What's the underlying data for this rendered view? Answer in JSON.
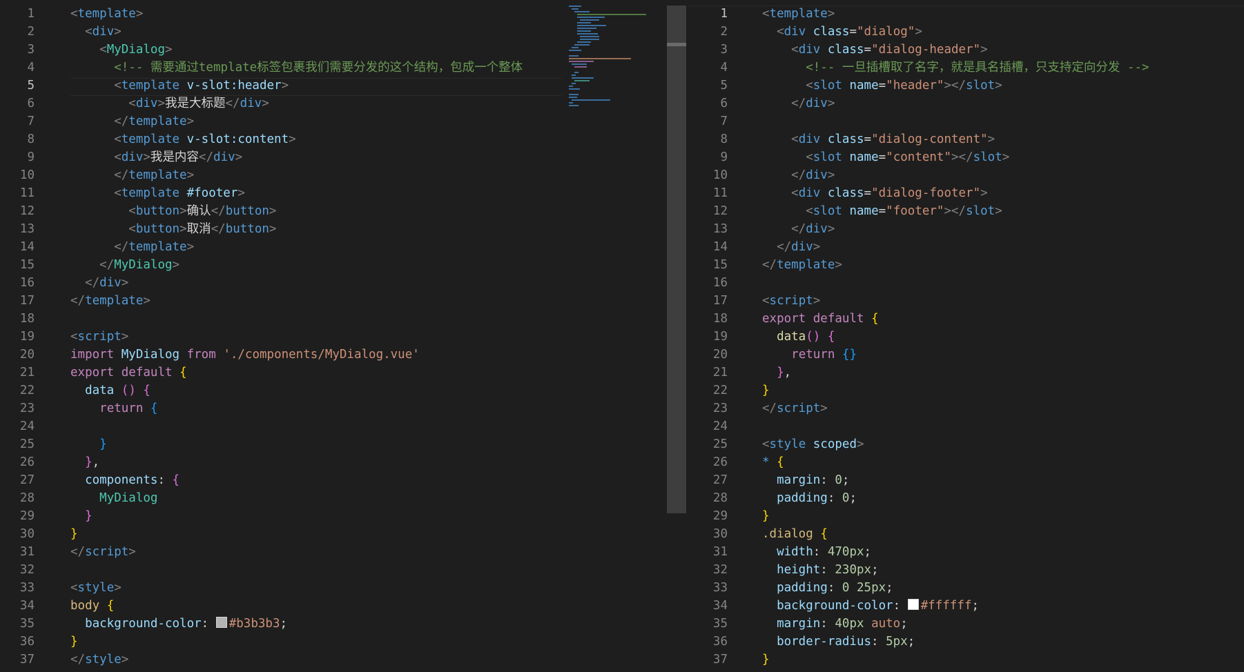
{
  "swatch_colors": {
    "left_swatch": "#b3b3b3",
    "right_swatch": "#ffffff"
  },
  "left_editor": {
    "active_line": 5,
    "lines": [
      [
        [
          "tag",
          "<"
        ],
        [
          "el",
          "template"
        ],
        [
          "tag",
          ">"
        ]
      ],
      [
        [
          "def",
          "  "
        ],
        [
          "tag",
          "<"
        ],
        [
          "el",
          "div"
        ],
        [
          "tag",
          ">"
        ]
      ],
      [
        [
          "def",
          "    "
        ],
        [
          "tag",
          "<"
        ],
        [
          "comp",
          "MyDialog"
        ],
        [
          "tag",
          ">"
        ]
      ],
      [
        [
          "def",
          "      "
        ],
        [
          "cmt",
          "<!-- 需要通过template标签包裹我们需要分发的这个结构，包成一个整体"
        ]
      ],
      [
        [
          "def",
          "      "
        ],
        [
          "tag",
          "<"
        ],
        [
          "el",
          "template"
        ],
        [
          "def",
          " "
        ],
        [
          "attr",
          "v-slot:header"
        ],
        [
          "tag",
          ">"
        ]
      ],
      [
        [
          "def",
          "        "
        ],
        [
          "tag",
          "<"
        ],
        [
          "el",
          "div"
        ],
        [
          "tag",
          ">"
        ],
        [
          "def",
          "我是大标题"
        ],
        [
          "tag",
          "</"
        ],
        [
          "el",
          "div"
        ],
        [
          "tag",
          ">"
        ]
      ],
      [
        [
          "def",
          "      "
        ],
        [
          "tag",
          "</"
        ],
        [
          "el",
          "template"
        ],
        [
          "tag",
          ">"
        ]
      ],
      [
        [
          "def",
          "      "
        ],
        [
          "tag",
          "<"
        ],
        [
          "el",
          "template"
        ],
        [
          "def",
          " "
        ],
        [
          "attr",
          "v-slot:content"
        ],
        [
          "tag",
          ">"
        ]
      ],
      [
        [
          "def",
          "      "
        ],
        [
          "tag",
          "<"
        ],
        [
          "el",
          "div"
        ],
        [
          "tag",
          ">"
        ],
        [
          "def",
          "我是内容"
        ],
        [
          "tag",
          "</"
        ],
        [
          "el",
          "div"
        ],
        [
          "tag",
          ">"
        ]
      ],
      [
        [
          "def",
          "      "
        ],
        [
          "tag",
          "</"
        ],
        [
          "el",
          "template"
        ],
        [
          "tag",
          ">"
        ]
      ],
      [
        [
          "def",
          "      "
        ],
        [
          "tag",
          "<"
        ],
        [
          "el",
          "template"
        ],
        [
          "def",
          " "
        ],
        [
          "attr",
          "#footer"
        ],
        [
          "tag",
          ">"
        ]
      ],
      [
        [
          "def",
          "        "
        ],
        [
          "tag",
          "<"
        ],
        [
          "el",
          "button"
        ],
        [
          "tag",
          ">"
        ],
        [
          "def",
          "确认"
        ],
        [
          "tag",
          "</"
        ],
        [
          "el",
          "button"
        ],
        [
          "tag",
          ">"
        ]
      ],
      [
        [
          "def",
          "        "
        ],
        [
          "tag",
          "<"
        ],
        [
          "el",
          "button"
        ],
        [
          "tag",
          ">"
        ],
        [
          "def",
          "取消"
        ],
        [
          "tag",
          "</"
        ],
        [
          "el",
          "button"
        ],
        [
          "tag",
          ">"
        ]
      ],
      [
        [
          "def",
          "      "
        ],
        [
          "tag",
          "</"
        ],
        [
          "el",
          "template"
        ],
        [
          "tag",
          ">"
        ]
      ],
      [
        [
          "def",
          "    "
        ],
        [
          "tag",
          "</"
        ],
        [
          "comp",
          "MyDialog"
        ],
        [
          "tag",
          ">"
        ]
      ],
      [
        [
          "def",
          "  "
        ],
        [
          "tag",
          "</"
        ],
        [
          "el",
          "div"
        ],
        [
          "tag",
          ">"
        ]
      ],
      [
        [
          "tag",
          "</"
        ],
        [
          "el",
          "template"
        ],
        [
          "tag",
          ">"
        ]
      ],
      [],
      [
        [
          "tag",
          "<"
        ],
        [
          "el",
          "script"
        ],
        [
          "tag",
          ">"
        ]
      ],
      [
        [
          "kw",
          "import"
        ],
        [
          "def",
          " "
        ],
        [
          "prop",
          "MyDialog"
        ],
        [
          "def",
          " "
        ],
        [
          "kw",
          "from"
        ],
        [
          "def",
          " "
        ],
        [
          "str",
          "'./components/MyDialog.vue'"
        ]
      ],
      [
        [
          "kw",
          "export"
        ],
        [
          "def",
          " "
        ],
        [
          "kw",
          "default"
        ],
        [
          "def",
          " "
        ],
        [
          "y",
          "{"
        ]
      ],
      [
        [
          "def",
          "  "
        ],
        [
          "prop",
          "data"
        ],
        [
          "def",
          " "
        ],
        [
          "p",
          "()"
        ],
        [
          "def",
          " "
        ],
        [
          "p",
          "{"
        ]
      ],
      [
        [
          "def",
          "    "
        ],
        [
          "kw",
          "return"
        ],
        [
          "def",
          " "
        ],
        [
          "b",
          "{"
        ]
      ],
      [],
      [
        [
          "def",
          "    "
        ],
        [
          "b",
          "}"
        ]
      ],
      [
        [
          "def",
          "  "
        ],
        [
          "p",
          "}"
        ],
        [
          "def",
          ","
        ]
      ],
      [
        [
          "def",
          "  "
        ],
        [
          "prop",
          "components"
        ],
        [
          "def",
          ": "
        ],
        [
          "p",
          "{"
        ]
      ],
      [
        [
          "def",
          "    "
        ],
        [
          "comp",
          "MyDialog"
        ]
      ],
      [
        [
          "def",
          "  "
        ],
        [
          "p",
          "}"
        ]
      ],
      [
        [
          "y",
          "}"
        ]
      ],
      [
        [
          "tag",
          "</"
        ],
        [
          "el",
          "script"
        ],
        [
          "tag",
          ">"
        ]
      ],
      [],
      [
        [
          "tag",
          "<"
        ],
        [
          "el",
          "style"
        ],
        [
          "tag",
          ">"
        ]
      ],
      [
        [
          "sel",
          "body"
        ],
        [
          "def",
          " "
        ],
        [
          "y",
          "{"
        ]
      ],
      [
        [
          "def",
          "  "
        ],
        [
          "prop",
          "background-color"
        ],
        [
          "def",
          ": "
        ],
        [
          "swatch",
          "left_swatch"
        ],
        [
          "str",
          "#b3b3b3"
        ],
        [
          "def",
          ";"
        ]
      ],
      [
        [
          "y",
          "}"
        ]
      ],
      [
        [
          "tag",
          "</"
        ],
        [
          "el",
          "style"
        ],
        [
          "tag",
          ">"
        ]
      ]
    ]
  },
  "right_editor": {
    "active_line": 1,
    "lines": [
      [
        [
          "tag",
          "<"
        ],
        [
          "el",
          "template"
        ],
        [
          "tag",
          ">"
        ]
      ],
      [
        [
          "def",
          "  "
        ],
        [
          "tag",
          "<"
        ],
        [
          "el",
          "div"
        ],
        [
          "def",
          " "
        ],
        [
          "attr",
          "class"
        ],
        [
          "def",
          "="
        ],
        [
          "str",
          "\"dialog\""
        ],
        [
          "tag",
          ">"
        ]
      ],
      [
        [
          "def",
          "    "
        ],
        [
          "tag",
          "<"
        ],
        [
          "el",
          "div"
        ],
        [
          "def",
          " "
        ],
        [
          "attr",
          "class"
        ],
        [
          "def",
          "="
        ],
        [
          "str",
          "\"dialog-header\""
        ],
        [
          "tag",
          ">"
        ]
      ],
      [
        [
          "def",
          "      "
        ],
        [
          "cmt",
          "<!-- 一旦插槽取了名字，就是具名插槽，只支持定向分发 -->"
        ]
      ],
      [
        [
          "def",
          "      "
        ],
        [
          "tag",
          "<"
        ],
        [
          "el",
          "slot"
        ],
        [
          "def",
          " "
        ],
        [
          "attr",
          "name"
        ],
        [
          "def",
          "="
        ],
        [
          "str",
          "\"header\""
        ],
        [
          "tag",
          "></"
        ],
        [
          "el",
          "slot"
        ],
        [
          "tag",
          ">"
        ]
      ],
      [
        [
          "def",
          "    "
        ],
        [
          "tag",
          "</"
        ],
        [
          "el",
          "div"
        ],
        [
          "tag",
          ">"
        ]
      ],
      [],
      [
        [
          "def",
          "    "
        ],
        [
          "tag",
          "<"
        ],
        [
          "el",
          "div"
        ],
        [
          "def",
          " "
        ],
        [
          "attr",
          "class"
        ],
        [
          "def",
          "="
        ],
        [
          "str",
          "\"dialog-content\""
        ],
        [
          "tag",
          ">"
        ]
      ],
      [
        [
          "def",
          "      "
        ],
        [
          "tag",
          "<"
        ],
        [
          "el",
          "slot"
        ],
        [
          "def",
          " "
        ],
        [
          "attr",
          "name"
        ],
        [
          "def",
          "="
        ],
        [
          "str",
          "\"content\""
        ],
        [
          "tag",
          "></"
        ],
        [
          "el",
          "slot"
        ],
        [
          "tag",
          ">"
        ]
      ],
      [
        [
          "def",
          "    "
        ],
        [
          "tag",
          "</"
        ],
        [
          "el",
          "div"
        ],
        [
          "tag",
          ">"
        ]
      ],
      [
        [
          "def",
          "    "
        ],
        [
          "tag",
          "<"
        ],
        [
          "el",
          "div"
        ],
        [
          "def",
          " "
        ],
        [
          "attr",
          "class"
        ],
        [
          "def",
          "="
        ],
        [
          "str",
          "\"dialog-footer\""
        ],
        [
          "tag",
          ">"
        ]
      ],
      [
        [
          "def",
          "      "
        ],
        [
          "tag",
          "<"
        ],
        [
          "el",
          "slot"
        ],
        [
          "def",
          " "
        ],
        [
          "attr",
          "name"
        ],
        [
          "def",
          "="
        ],
        [
          "str",
          "\"footer\""
        ],
        [
          "tag",
          "></"
        ],
        [
          "el",
          "slot"
        ],
        [
          "tag",
          ">"
        ]
      ],
      [
        [
          "def",
          "    "
        ],
        [
          "tag",
          "</"
        ],
        [
          "el",
          "div"
        ],
        [
          "tag",
          ">"
        ]
      ],
      [
        [
          "def",
          "  "
        ],
        [
          "tag",
          "</"
        ],
        [
          "el",
          "div"
        ],
        [
          "tag",
          ">"
        ]
      ],
      [
        [
          "tag",
          "</"
        ],
        [
          "el",
          "template"
        ],
        [
          "tag",
          ">"
        ]
      ],
      [],
      [
        [
          "tag",
          "<"
        ],
        [
          "el",
          "script"
        ],
        [
          "tag",
          ">"
        ]
      ],
      [
        [
          "kw",
          "export"
        ],
        [
          "def",
          " "
        ],
        [
          "kw",
          "default"
        ],
        [
          "def",
          " "
        ],
        [
          "y",
          "{"
        ]
      ],
      [
        [
          "def",
          "  "
        ],
        [
          "fn",
          "data"
        ],
        [
          "p",
          "()"
        ],
        [
          "def",
          " "
        ],
        [
          "p",
          "{"
        ]
      ],
      [
        [
          "def",
          "    "
        ],
        [
          "kw",
          "return"
        ],
        [
          "def",
          " "
        ],
        [
          "b",
          "{}"
        ]
      ],
      [
        [
          "def",
          "  "
        ],
        [
          "p",
          "}"
        ],
        [
          "def",
          ","
        ]
      ],
      [
        [
          "y",
          "}"
        ]
      ],
      [
        [
          "tag",
          "</"
        ],
        [
          "el",
          "script"
        ],
        [
          "tag",
          ">"
        ]
      ],
      [],
      [
        [
          "tag",
          "<"
        ],
        [
          "el",
          "style"
        ],
        [
          "def",
          " "
        ],
        [
          "attr",
          "scoped"
        ],
        [
          "tag",
          ">"
        ]
      ],
      [
        [
          "el",
          "*"
        ],
        [
          "def",
          " "
        ],
        [
          "y",
          "{"
        ]
      ],
      [
        [
          "def",
          "  "
        ],
        [
          "prop",
          "margin"
        ],
        [
          "def",
          ": "
        ],
        [
          "num",
          "0"
        ],
        [
          "def",
          ";"
        ]
      ],
      [
        [
          "def",
          "  "
        ],
        [
          "prop",
          "padding"
        ],
        [
          "def",
          ": "
        ],
        [
          "num",
          "0"
        ],
        [
          "def",
          ";"
        ]
      ],
      [
        [
          "y",
          "}"
        ]
      ],
      [
        [
          "sel",
          ".dialog"
        ],
        [
          "def",
          " "
        ],
        [
          "y",
          "{"
        ]
      ],
      [
        [
          "def",
          "  "
        ],
        [
          "prop",
          "width"
        ],
        [
          "def",
          ": "
        ],
        [
          "num",
          "470px"
        ],
        [
          "def",
          ";"
        ]
      ],
      [
        [
          "def",
          "  "
        ],
        [
          "prop",
          "height"
        ],
        [
          "def",
          ": "
        ],
        [
          "num",
          "230px"
        ],
        [
          "def",
          ";"
        ]
      ],
      [
        [
          "def",
          "  "
        ],
        [
          "prop",
          "padding"
        ],
        [
          "def",
          ": "
        ],
        [
          "num",
          "0"
        ],
        [
          "def",
          " "
        ],
        [
          "num",
          "25px"
        ],
        [
          "def",
          ";"
        ]
      ],
      [
        [
          "def",
          "  "
        ],
        [
          "prop",
          "background-color"
        ],
        [
          "def",
          ": "
        ],
        [
          "swatch",
          "right_swatch"
        ],
        [
          "str",
          "#ffffff"
        ],
        [
          "def",
          ";"
        ]
      ],
      [
        [
          "def",
          "  "
        ],
        [
          "prop",
          "margin"
        ],
        [
          "def",
          ": "
        ],
        [
          "num",
          "40px"
        ],
        [
          "def",
          " "
        ],
        [
          "str",
          "auto"
        ],
        [
          "def",
          ";"
        ]
      ],
      [
        [
          "def",
          "  "
        ],
        [
          "prop",
          "border-radius"
        ],
        [
          "def",
          ": "
        ],
        [
          "num",
          "5px"
        ],
        [
          "def",
          ";"
        ]
      ],
      [
        [
          "y",
          "}"
        ]
      ]
    ]
  }
}
